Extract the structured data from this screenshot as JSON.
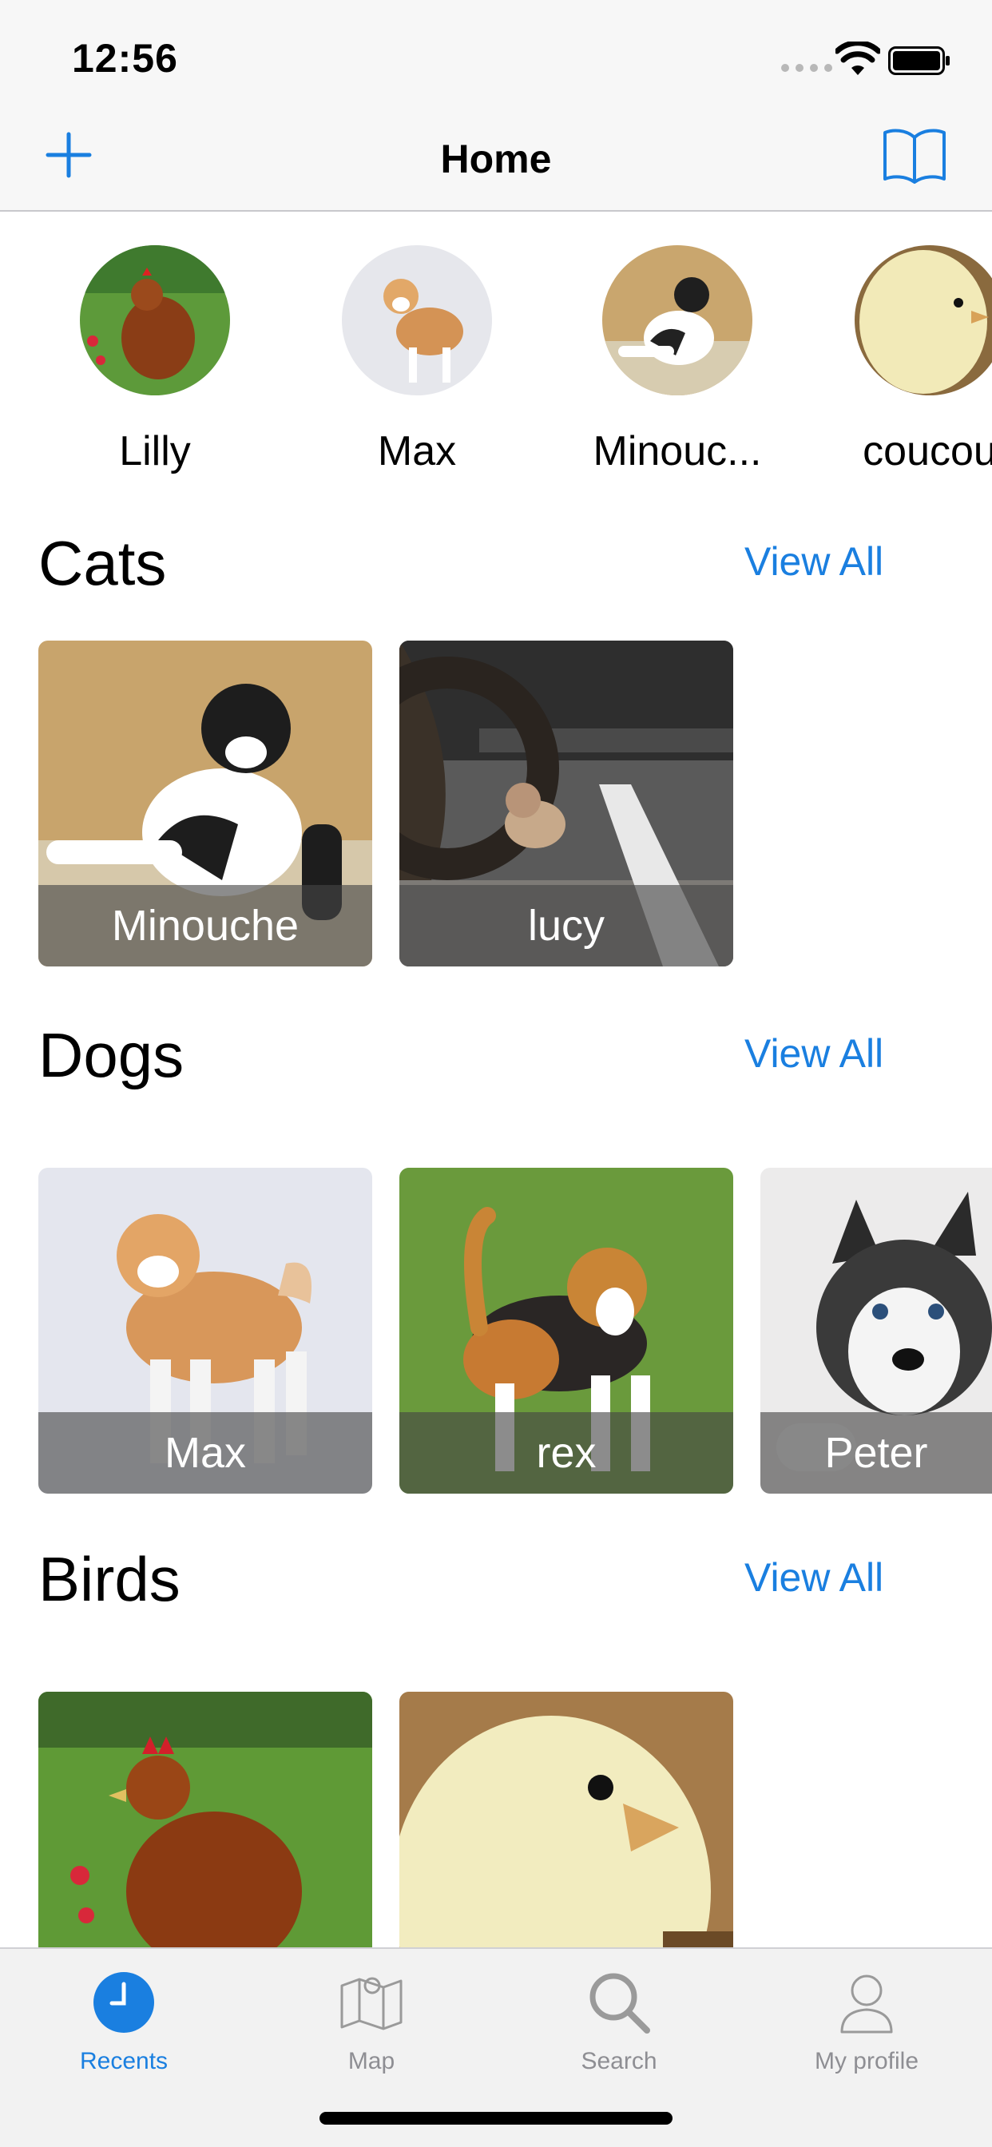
{
  "status_bar": {
    "time": "12:56"
  },
  "nav": {
    "title": "Home"
  },
  "favorites": [
    {
      "name": "Lilly"
    },
    {
      "name": "Max"
    },
    {
      "name": "Minouc..."
    },
    {
      "name": "coucou"
    }
  ],
  "sections": {
    "cats": {
      "title": "Cats",
      "view_all": "View All",
      "items": [
        {
          "name": "Minouche"
        },
        {
          "name": "lucy"
        }
      ]
    },
    "dogs": {
      "title": "Dogs",
      "view_all": "View All",
      "items": [
        {
          "name": "Max"
        },
        {
          "name": "rex"
        },
        {
          "name": "Peter"
        }
      ]
    },
    "birds": {
      "title": "Birds",
      "view_all": "View All",
      "items": [
        {
          "name": ""
        },
        {
          "name": ""
        }
      ]
    }
  },
  "tabs": [
    {
      "label": "Recents",
      "icon": "clock-icon",
      "active": true
    },
    {
      "label": "Map",
      "icon": "map-icon",
      "active": false
    },
    {
      "label": "Search",
      "icon": "search-icon",
      "active": false
    },
    {
      "label": "My profile",
      "icon": "person-icon",
      "active": false
    }
  ],
  "colors": {
    "accent": "#1a7fe0",
    "bar_background": "#f7f7f7",
    "tab_inactive": "#8e8e93"
  }
}
